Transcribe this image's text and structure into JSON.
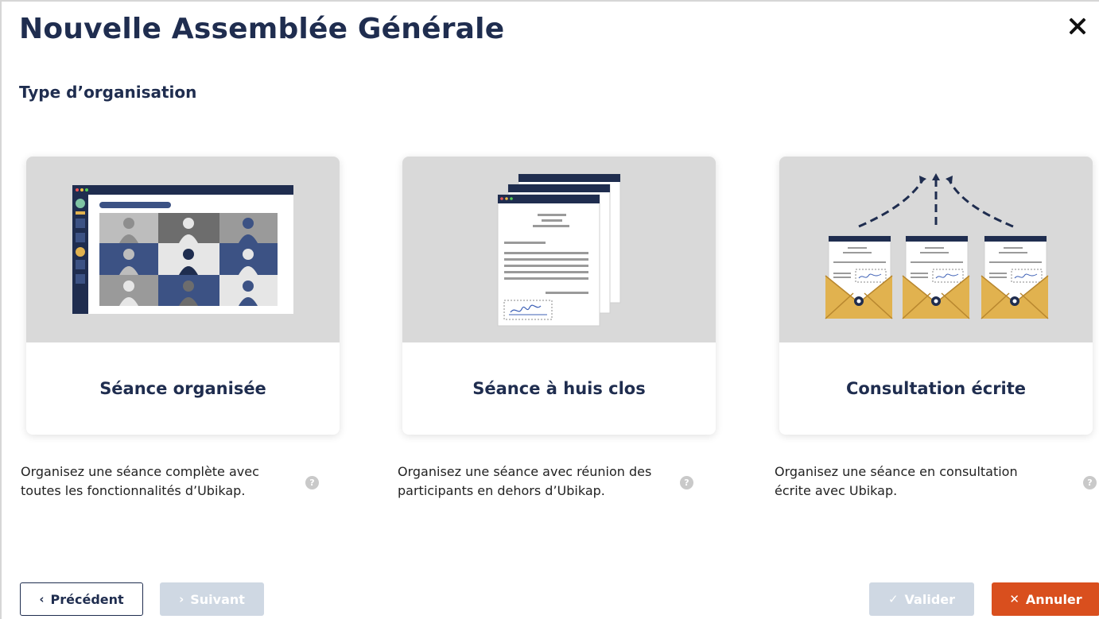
{
  "modal": {
    "title": "Nouvelle Assemblée Générale",
    "section_title": "Type d’organisation"
  },
  "options": [
    {
      "label": "Séance organisée",
      "description": "Organisez une séance complète avec toutes les fonctionnalités d’Ubikap.",
      "illustration": "video-conference-illustration"
    },
    {
      "label": "Séance à huis clos",
      "description": "Organisez une séance avec réunion des participants en dehors d’Ubikap.",
      "illustration": "signed-documents-illustration"
    },
    {
      "label": "Consultation écrite",
      "description": "Organisez une séance en consultation écrite avec Ubikap.",
      "illustration": "envelopes-illustration"
    }
  ],
  "help_glyph": "?",
  "footer": {
    "previous_label": "Précédent",
    "previous_glyph": "‹",
    "next_label": "Suivant",
    "next_glyph": "›",
    "validate_label": "Valider",
    "validate_glyph": "✓",
    "cancel_label": "Annuler",
    "cancel_glyph": "✕"
  },
  "colors": {
    "navy": "#1f2d4f",
    "accent_orange": "#d94f1e",
    "disabled_button": "#cfd8e3",
    "illustration_bg": "#d9d9d9",
    "envelope_gold": "#e1b24f",
    "tile_blue": "#3c5284"
  }
}
